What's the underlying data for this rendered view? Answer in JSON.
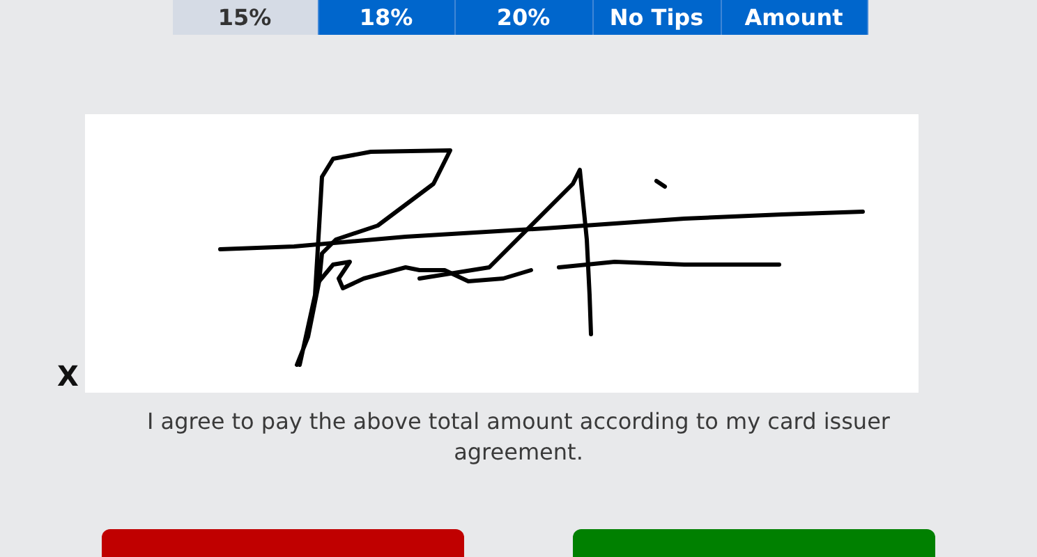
{
  "tip_options": [
    {
      "label": "15%",
      "selected": true
    },
    {
      "label": "18%",
      "selected": false
    },
    {
      "label": "20%",
      "selected": false
    },
    {
      "label": "No Tips",
      "selected": false
    },
    {
      "label": "Amount",
      "selected": false
    }
  ],
  "signature": {
    "marker": "X"
  },
  "agreement": "I agree to pay the above total amount according to my card issuer agreement.",
  "actions": [
    {
      "kind": "cancel"
    },
    {
      "kind": "confirm"
    }
  ]
}
